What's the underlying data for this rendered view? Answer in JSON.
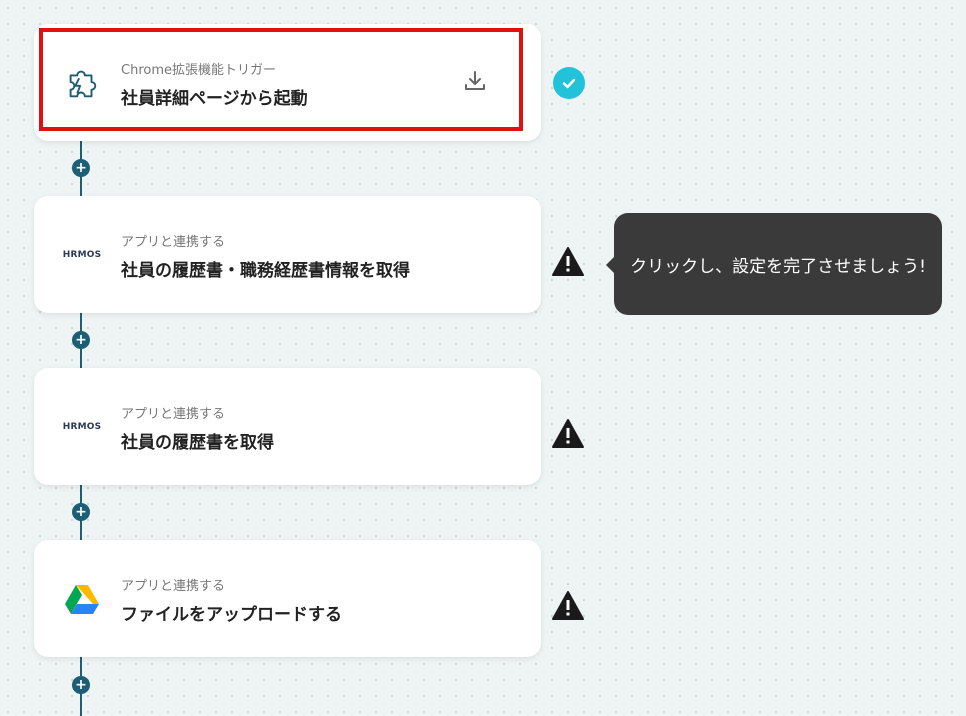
{
  "flow": {
    "steps": [
      {
        "sub": "Chrome拡張機能トリガー",
        "title": "社員詳細ページから起動",
        "icon": "puzzle-icon",
        "status": "complete",
        "highlighted": true
      },
      {
        "sub": "アプリと連携する",
        "title": "社員の履歴書・職務経歴書情報を取得",
        "icon": "hrmos-logo",
        "logo_text": "HRMOS",
        "status": "warning"
      },
      {
        "sub": "アプリと連携する",
        "title": "社員の履歴書を取得",
        "icon": "hrmos-logo",
        "logo_text": "HRMOS",
        "status": "warning"
      },
      {
        "sub": "アプリと連携する",
        "title": "ファイルをアップロードする",
        "icon": "google-drive-icon",
        "status": "warning"
      }
    ],
    "add_label": "+"
  },
  "tooltip": {
    "text": "クリックし、設定を完了させましょう!"
  },
  "colors": {
    "connector": "#1c5e74",
    "check": "#22c2da",
    "highlight": "#e01010",
    "tooltip_bg": "#3a3a3a"
  }
}
